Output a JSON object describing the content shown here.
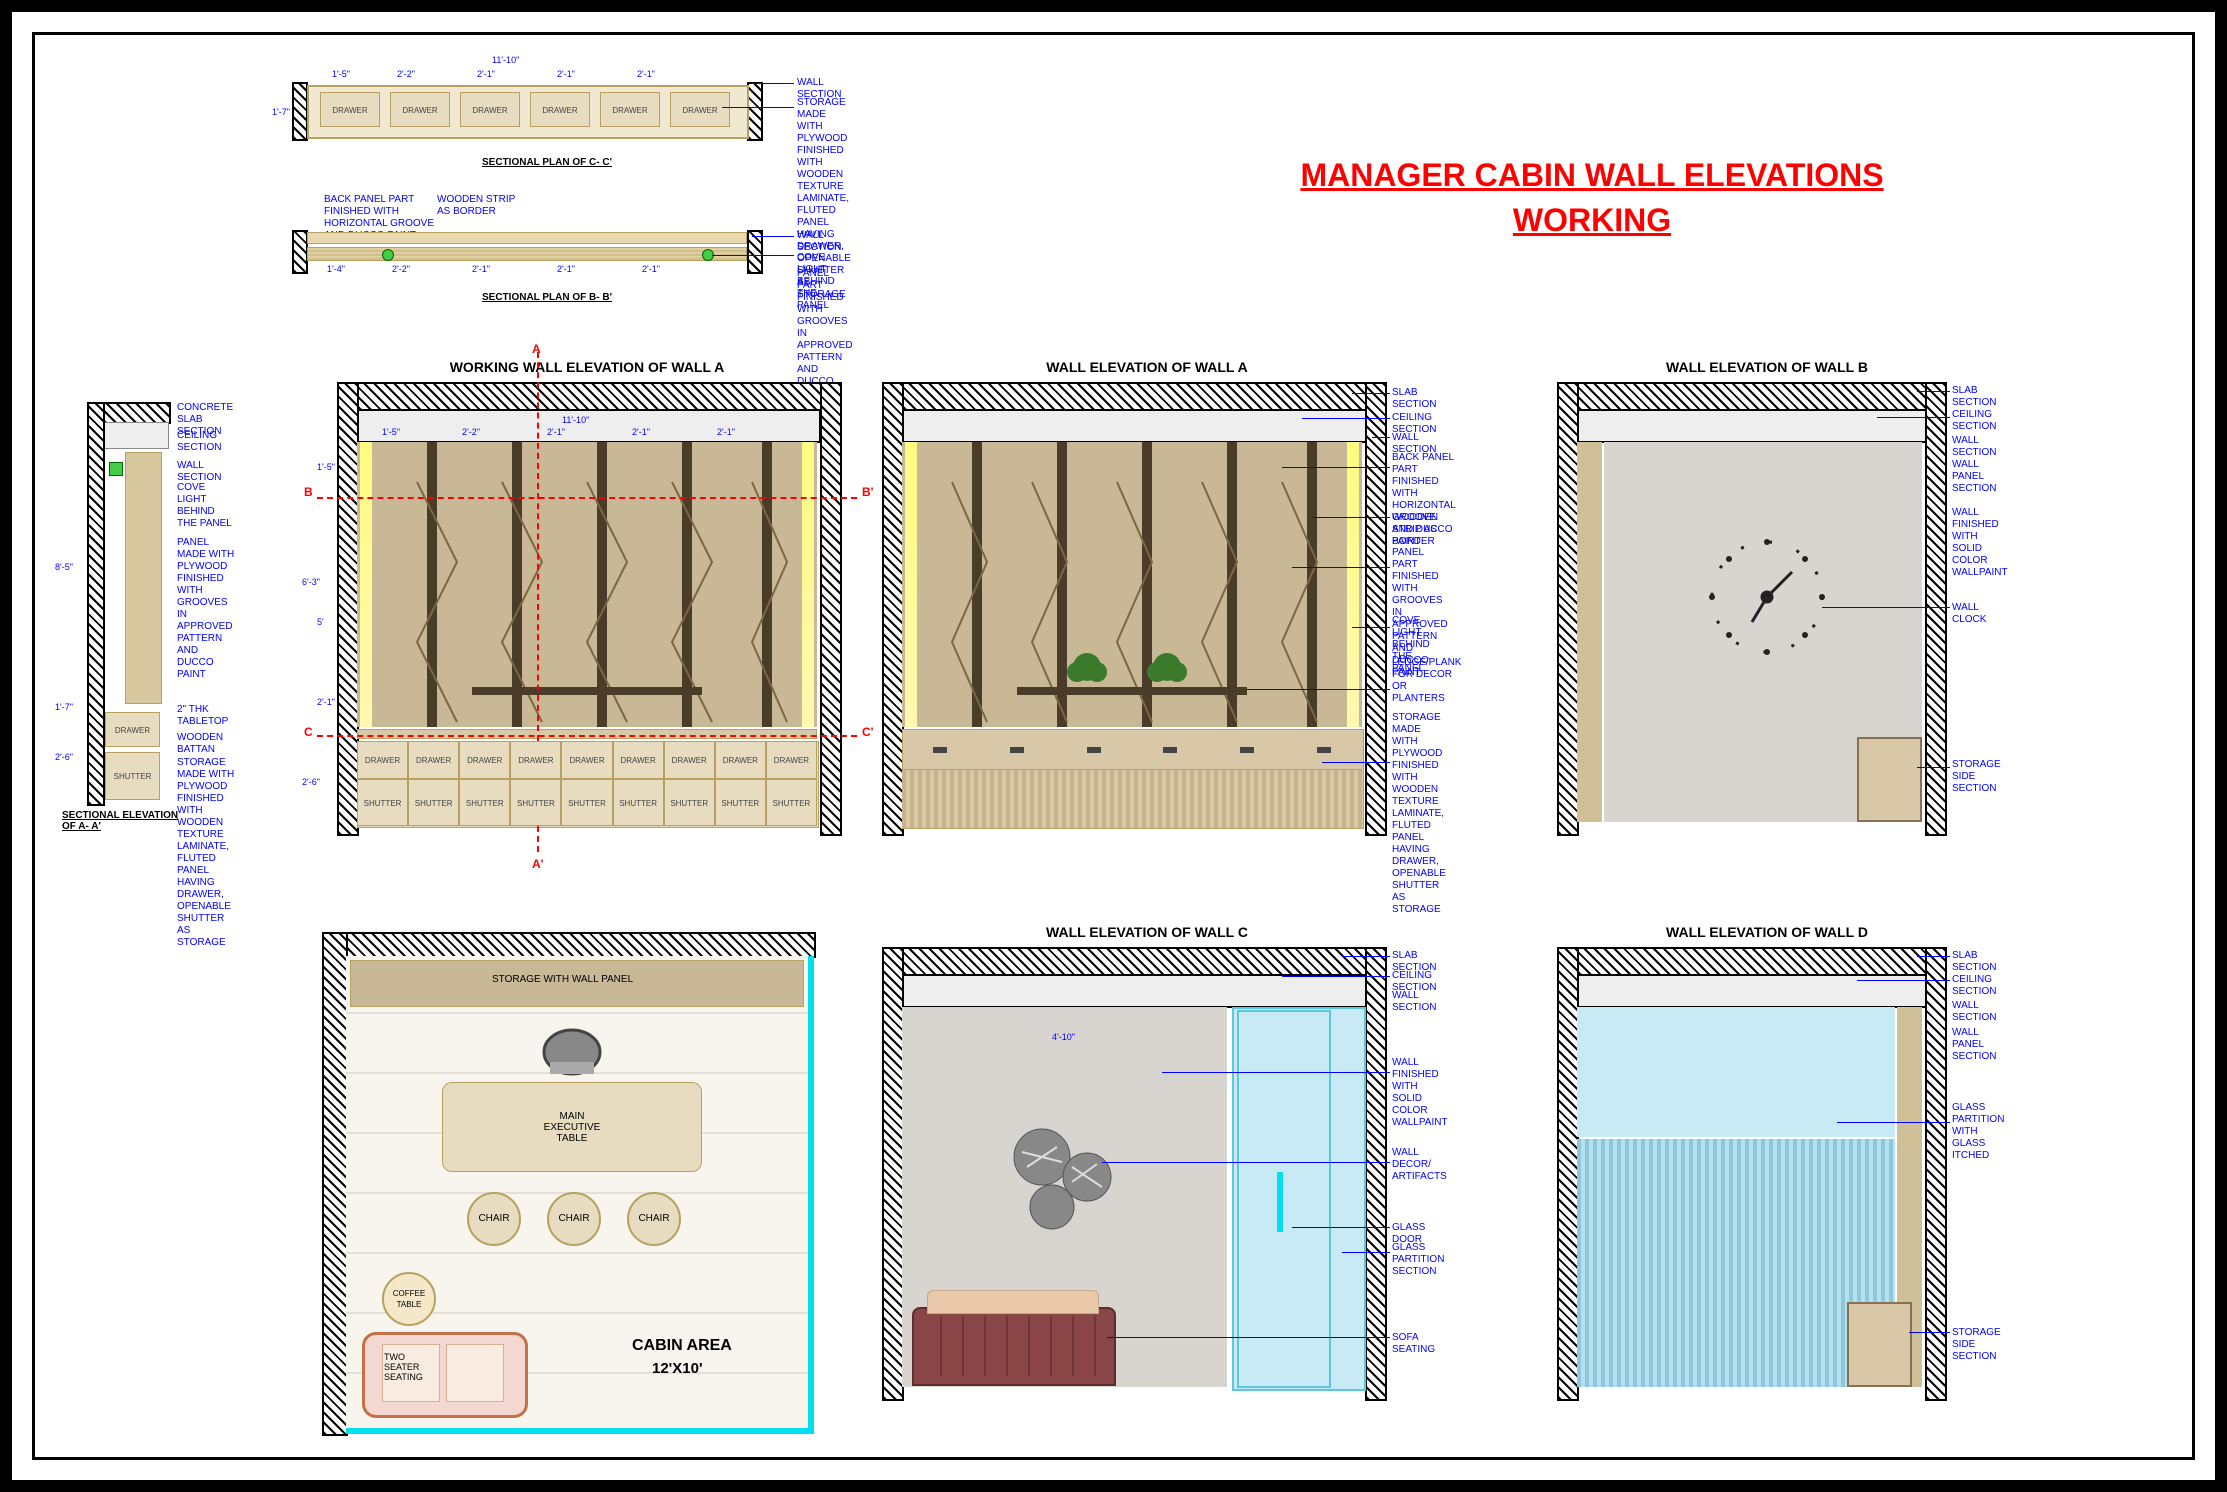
{
  "title": {
    "line1": "MANAGER CABIN WALL ELEVATIONS",
    "line2": "WORKING"
  },
  "section_cc": {
    "title": "SECTIONAL PLAN OF C- C'",
    "total": "11'-10\"",
    "sub": [
      "1'-5\"",
      "2'-2\"",
      "2'-1\"",
      "2'-1\"",
      "2'-1\""
    ],
    "depth": "1'-7\"",
    "drawer": "DRAWER",
    "n1": "WALL SECTION",
    "n2": "STORAGE MADE WITH PLYWOOD FINISHED WITH WOODEN TEXTURE LAMINATE, FLUTED PANEL HAVING DRAWER, OPENABLE SHUTTER AS STORAGE"
  },
  "section_bb": {
    "title": "SECTIONAL PLAN OF B- B'",
    "n1": "BACK PANEL PART FINISHED WITH HORIZONTAL GROOVE AND DUCCO PAINT",
    "n2": "WOODEN STRIP AS BORDER",
    "n3": "WALL SECTION",
    "n4": "COVE LIGHT BEHIND THE PANEL",
    "n5": "PANEL PART FINISHED WITH GROOVES IN APPROVED PATTERN AND DUCCO PAINT",
    "dims": [
      "1'-4\"",
      "2'-2\"",
      "2'-1\"",
      "2'-1\"",
      "2'-1\""
    ]
  },
  "section_aa": {
    "title": "SECTIONAL ELEVATION OF A- A'",
    "height": "8'-5\"",
    "drawer_h": "2'-6\"",
    "tabletop": "1'-7\"",
    "n1": "CONCRETE SLAB SECTION",
    "n2": "CEILING SECTION",
    "n3": "WALL SECTION",
    "n4": "COVE LIGHT BEHIND THE PANEL",
    "n5": "PANEL MADE WITH PLYWOOD FINISHED WITH GROOVES IN APPROVED PATTERN AND DUCCO PAINT",
    "n6": "2\" THK TABLETOP",
    "n7": "WOODEN BATTAN",
    "n8": "STORAGE MADE WITH PLYWOOD FINISHED WITH WOODEN TEXTURE LAMINATE, FLUTED PANEL HAVING DRAWER, OPENABLE SHUTTER AS STORAGE",
    "drawer": "DRAWER",
    "shutter": "SHUTTER"
  },
  "elev_wa_working": {
    "title": "WORKING WALL ELEVATION OF WALL A",
    "marks": {
      "A": "A",
      "A2": "A'",
      "B": "B",
      "B2": "B'",
      "C": "C",
      "C2": "C'"
    },
    "top": "11'-10\"",
    "subs": [
      "1'-5\"",
      "2'-2\"",
      "2'-1\"",
      "2'-1\"",
      "2'-1\""
    ],
    "h": "6'-3\"",
    "h2": "2'-6\"",
    "h3": "1'-5\"",
    "h4": "5'",
    "h5": "2'-1\"",
    "drawer": "DRAWER",
    "shutter": "SHUTTER"
  },
  "elev_wa": {
    "title": "WALL ELEVATION OF WALL A",
    "n1": "SLAB SECTION",
    "n2": "CEILING SECTION",
    "n3": "WALL SECTION",
    "n4": "BACK PANEL PART FINISHED WITH HORIZONTAL GROOVE AND DUCCO PAINT",
    "n5": "WOODEN STRIP AS BORDER",
    "n6": "PANEL PART FINISHED WITH GROOVES IN APPROVED PATTERN AND DUCCO PAINT",
    "n7": "COVE LIGHT BEHIND THE PANEL",
    "n8": "LEDGE/PLANK FOR DECOR OR PLANTERS",
    "n9": "STORAGE MADE WITH PLYWOOD FINISHED WITH WOODEN TEXTURE LAMINATE, FLUTED PANEL HAVING DRAWER, OPENABLE SHUTTER AS STORAGE"
  },
  "elev_wb": {
    "title": "WALL ELEVATION OF WALL B",
    "n1": "SLAB SECTION",
    "n2": "CEILING SECTION",
    "n3": "WALL SECTION",
    "n4": "WALL PANEL SECTION",
    "n5": "WALL FINISHED WITH SOLID COLOR WALLPAINT",
    "n6": "WALL CLOCK",
    "n7": "STORAGE SIDE SECTION"
  },
  "plan": {
    "title": "CABIN AREA",
    "size": "12'X10'",
    "storage": "STORAGE WITH WALL PANEL",
    "table": "MAIN\nEXECUTIVE\nTABLE",
    "chair": "CHAIR",
    "coffee": "COFFEE\nTABLE",
    "sofa": "TWO\nSEATER\nSEATING"
  },
  "elev_wc": {
    "title": "WALL ELEVATION OF WALL C",
    "dim": "4'-10\"",
    "n1": "SLAB SECTION",
    "n2": "CEILING SECTION",
    "n3": "WALL SECTION",
    "n4": "WALL FINISHED WITH SOLID COLOR WALLPAINT",
    "n5": "WALL DECOR/ ARTIFACTS",
    "n6": "GLASS DOOR",
    "n7": "GLASS PARTITION SECTION",
    "n8": "SOFA SEATING"
  },
  "elev_wd": {
    "title": "WALL ELEVATION OF WALL D",
    "n1": "SLAB SECTION",
    "n2": "CEILING SECTION",
    "n3": "WALL SECTION",
    "n4": "WALL PANEL SECTION",
    "n5": "GLASS PARTITION WITH GLASS ITCHED",
    "n6": "STORAGE SIDE SECTION"
  }
}
